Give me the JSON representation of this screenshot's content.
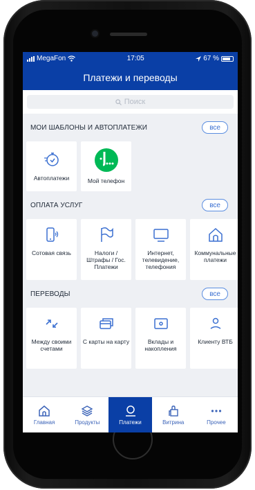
{
  "status": {
    "carrier": "MegaFon",
    "time": "17:05",
    "battery": "67 %"
  },
  "header": {
    "title": "Платежи и переводы"
  },
  "search": {
    "placeholder": "Поиск"
  },
  "sections": [
    {
      "title": "МОИ ШАБЛОНЫ И АВТОПЛАТЕЖИ",
      "all_label": "все",
      "items": [
        {
          "label": "Автоплатежи",
          "icon": "stopwatch-icon"
        },
        {
          "label": "Мой телефон",
          "icon": "megafon-logo"
        }
      ]
    },
    {
      "title": "ОПЛАТА УСЛУГ",
      "all_label": "все",
      "items": [
        {
          "label": "Сотовая связь",
          "icon": "mobile-icon"
        },
        {
          "label": "Налоги / Штрафы / Гос. Платежи",
          "icon": "flag-icon"
        },
        {
          "label": "Интернет, телевидение, телефония",
          "icon": "tv-icon"
        },
        {
          "label": "Коммунальные платежи",
          "icon": "home-icon"
        }
      ]
    },
    {
      "title": "ПЕРЕВОДЫ",
      "all_label": "все",
      "items": [
        {
          "label": "Между своими счетами",
          "icon": "arrows-icon"
        },
        {
          "label": "С карты на карту",
          "icon": "cards-icon"
        },
        {
          "label": "Вклады и накопления",
          "icon": "wallet-icon"
        },
        {
          "label": "Клиенту ВТБ",
          "icon": "person-icon"
        }
      ]
    }
  ],
  "tabbar": [
    {
      "label": "Главная",
      "icon": "home-icon",
      "active": false
    },
    {
      "label": "Продукты",
      "icon": "layers-icon",
      "active": false
    },
    {
      "label": "Платежи",
      "icon": "payments-icon",
      "active": true
    },
    {
      "label": "Витрина",
      "icon": "shopping-bag-icon",
      "active": false
    },
    {
      "label": "Прочее",
      "icon": "more-icon",
      "active": false
    }
  ],
  "colors": {
    "primary": "#0a3fa6",
    "accent": "#3a6fd1",
    "megafon_green": "#00b956"
  }
}
